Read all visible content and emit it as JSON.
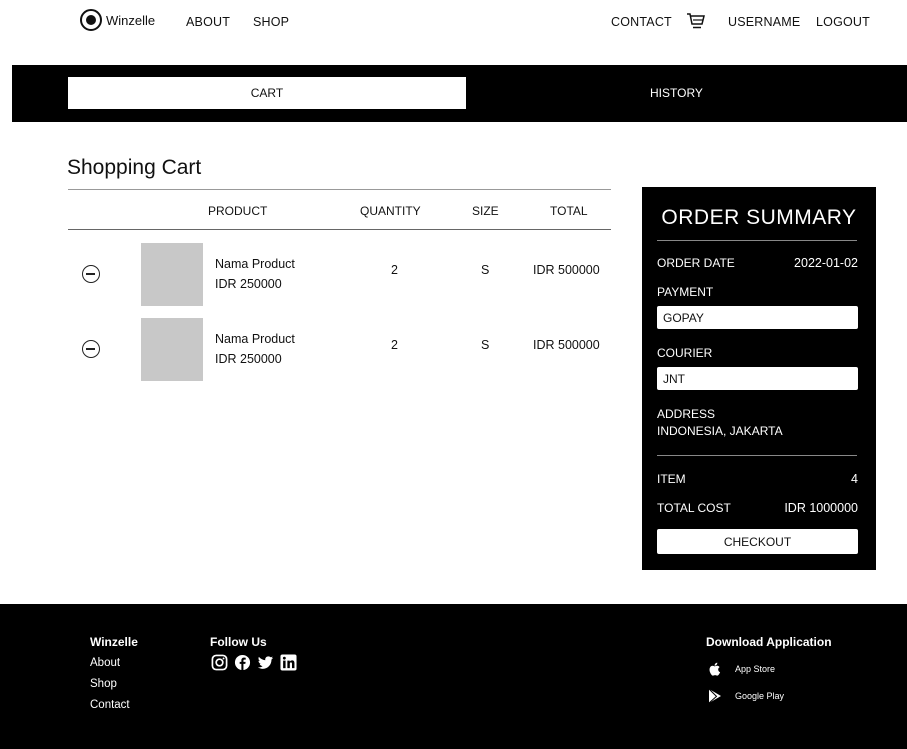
{
  "header": {
    "brand": "Winzelle",
    "nav_left": [
      "ABOUT",
      "SHOP"
    ],
    "contact": "CONTACT",
    "cart_icon": "cart-icon",
    "username": "USERNAME",
    "logout": "LOGOUT"
  },
  "tabs": {
    "cart": "CART",
    "history": "HISTORY"
  },
  "cart": {
    "title": "Shopping Cart",
    "columns": {
      "product": "PRODUCT",
      "quantity": "QUANTITY",
      "size": "SIZE",
      "total": "TOTAL"
    },
    "items": [
      {
        "name": "Nama Product",
        "price": "IDR 250000",
        "quantity": "2",
        "size": "S",
        "total": "IDR 500000"
      },
      {
        "name": "Nama Product",
        "price": "IDR 250000",
        "quantity": "2",
        "size": "S",
        "total": "IDR 500000"
      }
    ]
  },
  "summary": {
    "title": "ORDER SUMMARY",
    "order_date_label": "ORDER DATE",
    "order_date": "2022-01-02",
    "payment_label": "PAYMENT",
    "payment_value": "GOPAY",
    "courier_label": "COURIER",
    "courier_value": "JNT",
    "address_label": "ADDRESS",
    "address_value": "INDONESIA, JAKARTA",
    "item_label": "ITEM",
    "item_value": "4",
    "total_label": "TOTAL COST",
    "total_value": "IDR 1000000",
    "checkout": "CHECKOUT"
  },
  "footer": {
    "brand": "Winzelle",
    "links": [
      "About",
      "Shop",
      "Contact"
    ],
    "follow_title": "Follow Us",
    "social_icons": [
      "instagram-icon",
      "facebook-icon",
      "twitter-icon",
      "linkedin-icon"
    ],
    "download_title": "Download Application",
    "app_store": "App Store",
    "google_play": "Google Play"
  }
}
